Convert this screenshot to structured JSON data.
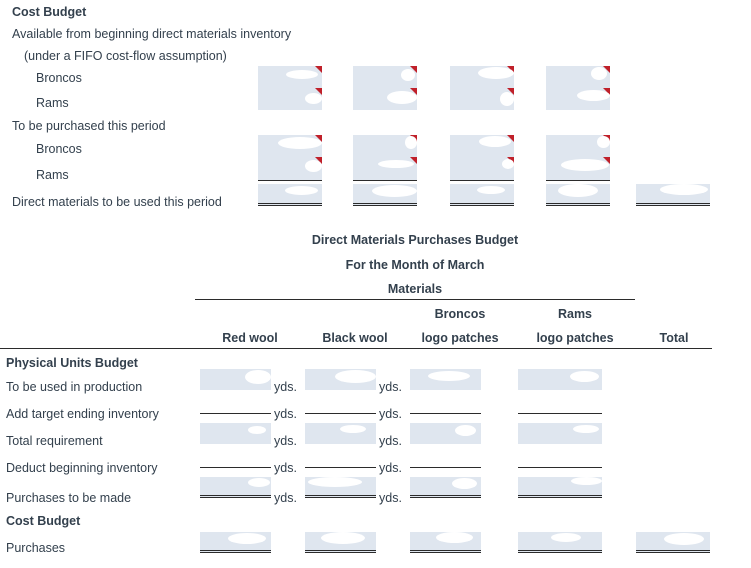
{
  "upper_section": {
    "heading": "Cost Budget",
    "lines": [
      {
        "text": "Available from beginning direct materials inventory",
        "indent": 0
      },
      {
        "text": "(under a FIFO cost-flow assumption)",
        "indent": 1
      },
      {
        "text": "Broncos",
        "indent": 2
      },
      {
        "text": "Rams",
        "indent": 2
      },
      {
        "text": "To be purchased this period",
        "indent": 0
      },
      {
        "text": "Broncos",
        "indent": 2
      },
      {
        "text": "Rams",
        "indent": 2
      },
      {
        "text": "Direct materials to be used this period",
        "indent": 0
      }
    ],
    "currency_symbol": "$",
    "fields": {
      "broncos_beginning": [
        "",
        "",
        "",
        ""
      ],
      "rams_beginning": [
        "",
        "",
        "",
        ""
      ],
      "broncos_purchased": [
        "",
        "",
        "",
        ""
      ],
      "rams_purchased": [
        "",
        "",
        "",
        ""
      ],
      "direct_materials_used": [
        "",
        "",
        "",
        "",
        ""
      ]
    }
  },
  "report": {
    "title": "Direct Materials Purchases Budget",
    "subtitle": "For the Month of March",
    "group_header": "Materials",
    "columns": [
      {
        "top": "",
        "bottom": "Red wool"
      },
      {
        "top": "",
        "bottom": "Black wool"
      },
      {
        "top": "Broncos",
        "bottom": "logo patches"
      },
      {
        "top": "Rams",
        "bottom": "logo patches"
      },
      {
        "top": "",
        "bottom": "Total"
      }
    ]
  },
  "physical_units": {
    "section_heading": "Physical Units Budget",
    "unit_label": "yds.",
    "rows": [
      {
        "label": "To be used in production",
        "style": "shaded",
        "values": [
          "",
          "",
          "",
          ""
        ]
      },
      {
        "label": "Add target ending inventory",
        "style": "plain-underline",
        "values": [
          "",
          "",
          "",
          ""
        ]
      },
      {
        "label": "Total requirement",
        "style": "shaded",
        "values": [
          "",
          "",
          "",
          ""
        ]
      },
      {
        "label": "Deduct beginning inventory",
        "style": "plain-underline",
        "values": [
          "",
          "",
          "",
          ""
        ]
      },
      {
        "label": "Purchases to be made",
        "style": "shaded-double",
        "values": [
          "",
          "",
          "",
          ""
        ]
      }
    ]
  },
  "cost_budget": {
    "section_heading": "Cost Budget",
    "currency_symbol": "$",
    "rows": [
      {
        "label": "Purchases",
        "style": "shaded-double",
        "values": [
          "",
          "",
          "",
          "",
          ""
        ]
      }
    ]
  },
  "colors": {
    "field_fill": "#dfe6ef",
    "rule": "#2b2b2b",
    "text": "#33404d",
    "flag_marker": "#c0202a"
  }
}
